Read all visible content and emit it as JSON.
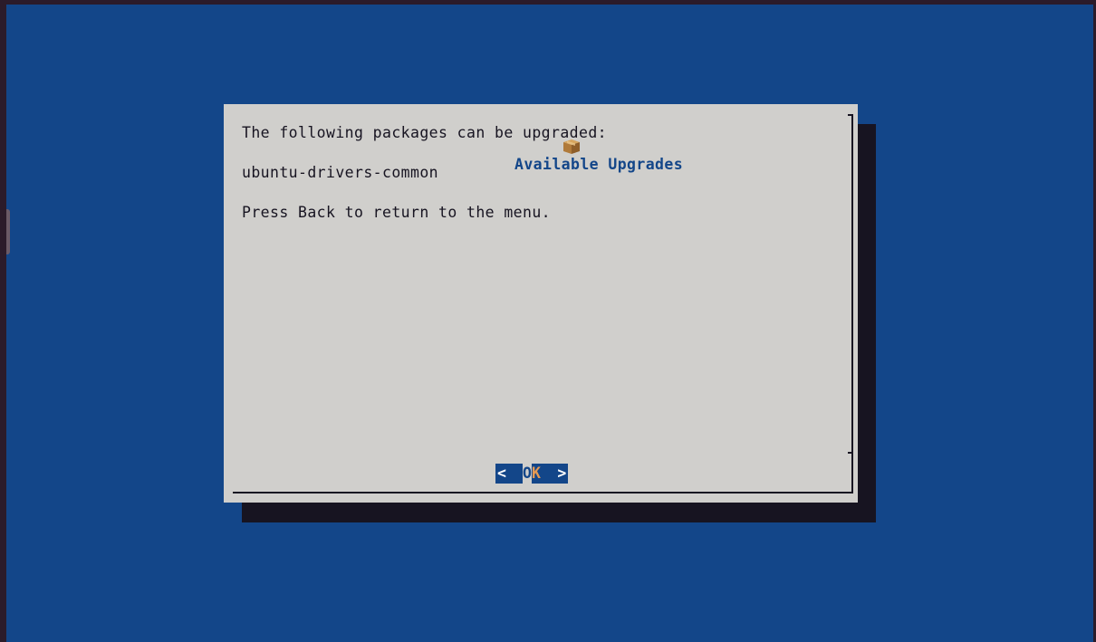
{
  "dialog": {
    "title": "Available Upgrades",
    "title_icon": "package-icon",
    "lines": [
      "The following packages can be upgraded:",
      "ubuntu-drivers-common",
      "Press Back to return to the menu."
    ]
  },
  "ok_button": {
    "open_bracket": "<",
    "first_letter": "O",
    "hot_letter": "K",
    "close_bracket": ">"
  },
  "colors": {
    "terminal_bg": "#134689",
    "dialog_bg": "#d0cfcc",
    "shadow": "#171421",
    "title_fg": "#134689",
    "button_bg": "#134689",
    "button_hotkey": "#e59952"
  }
}
